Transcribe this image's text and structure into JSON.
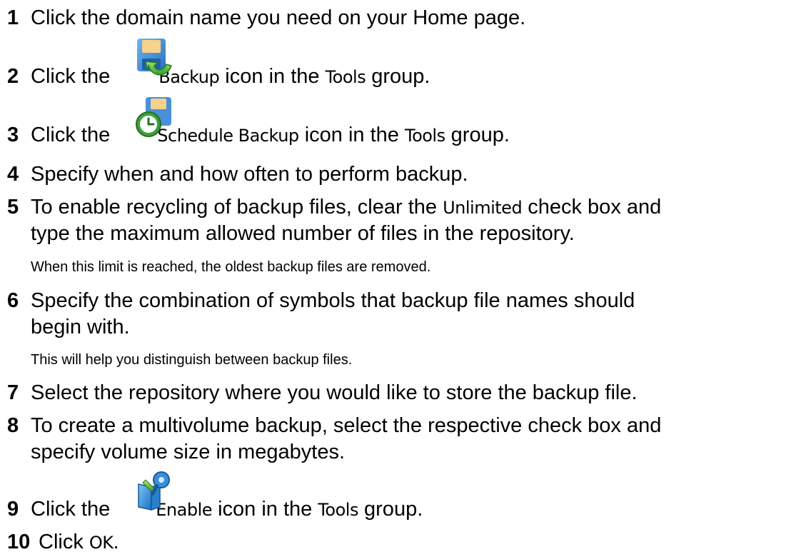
{
  "steps": [
    {
      "num": "1",
      "parts": [
        "Click the domain name you need on your Home page."
      ]
    },
    {
      "num": "2",
      "pre": "Click the ",
      "icon": "backup-icon",
      "ui": "Backup",
      "mid": " icon in the ",
      "ui2": "Tools",
      "post": " group."
    },
    {
      "num": "3",
      "pre": "Click the ",
      "icon": "schedule-backup-icon",
      "ui": "Schedule Backup",
      "mid": " icon in the ",
      "ui2": "Tools",
      "post": " group."
    },
    {
      "num": "4",
      "text": "Specify when and how often to perform backup."
    },
    {
      "num": "5",
      "pre": "To enable recycling of backup files, clear the ",
      "ui": "Unlimited",
      "post": " check box and",
      "line2": "type the maximum allowed number of files in the repository.",
      "note": "When this limit is reached, the oldest backup files are removed."
    },
    {
      "num": "6",
      "text": "Specify the combination of symbols that backup file names should",
      "line2": "begin with.",
      "note": "This will help you distinguish between backup files."
    },
    {
      "num": "7",
      "text": "Select the repository where you would like to store the backup file."
    },
    {
      "num": "8",
      "text": "To create a multivolume backup, select the respective check box and",
      "line2": "specify volume size in megabytes."
    },
    {
      "num": "9",
      "pre": "Click the ",
      "icon": "enable-icon",
      "ui": "Enable",
      "mid": " icon in the ",
      "ui2": "Tools",
      "post": " group."
    },
    {
      "num": "10",
      "pre": "Click ",
      "ui": "OK",
      "post": "."
    }
  ]
}
